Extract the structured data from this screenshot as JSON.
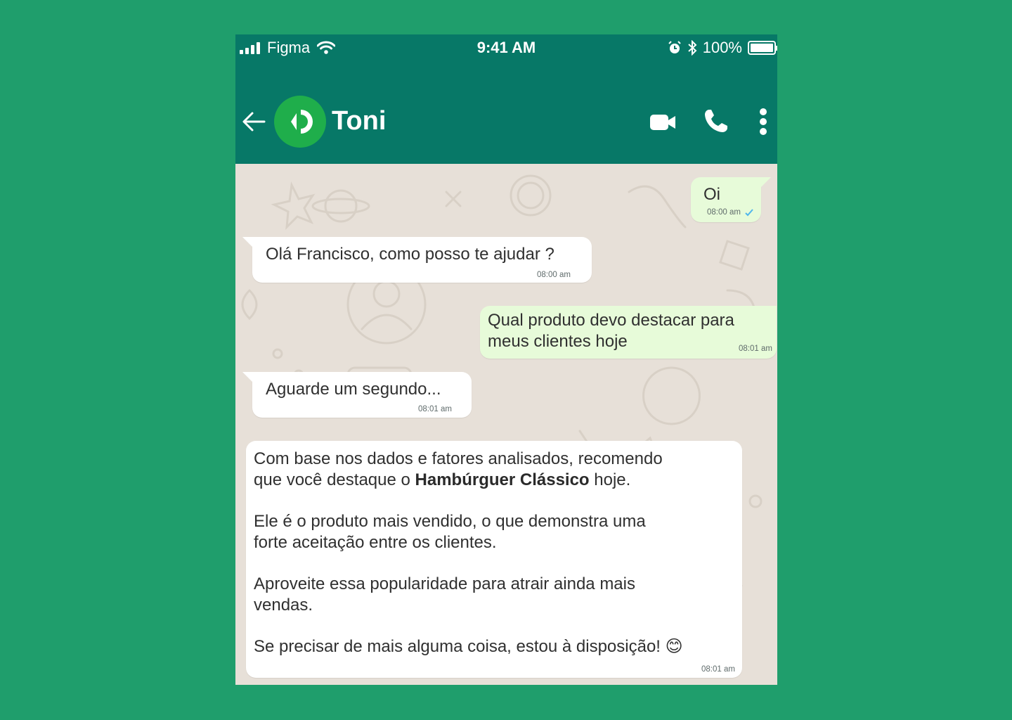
{
  "status_bar": {
    "carrier": "Figma",
    "time": "9:41 AM",
    "battery": "100%"
  },
  "header": {
    "contact_name": "Toni",
    "icons": [
      "back-arrow-icon",
      "video-call-icon",
      "phone-icon",
      "more-vertical-icon"
    ]
  },
  "messages": [
    {
      "direction": "out",
      "text": "Oi",
      "time": "08:00 am",
      "status": "delivered-check"
    },
    {
      "direction": "in",
      "text": "Olá Francisco, como posso te ajudar ?",
      "time": "08:00 am"
    },
    {
      "direction": "out",
      "line1": "Qual produto devo destacar para",
      "line2": "meus clientes hoje",
      "time": "08:01 am"
    },
    {
      "direction": "in",
      "text": "Aguarde um segundo...",
      "time": "08:01 am"
    },
    {
      "direction": "in",
      "p1_line1": "Com base nos dados e fatores analisados, recomendo",
      "p1_line2_prefix": "que você destaque o ",
      "p1_bold": "Hambúrguer Clássico",
      "p1_line2_suffix": " hoje.",
      "p2_line1": "Ele é o produto mais vendido, o que demonstra uma",
      "p2_line2": "forte aceitação entre os clientes.",
      "p3_line1": "Aproveite essa popularidade para atrair ainda mais",
      "p3_line2": "vendas.",
      "p4": "Se precisar de mais alguma coisa, estou à disposição! 😊",
      "time": "08:01 am"
    }
  ],
  "colors": {
    "background": "#1f9e6c",
    "header": "#077867",
    "chat_background": "#e7e0d8",
    "incoming_bubble": "#ffffff",
    "outgoing_bubble": "#e7fbd9",
    "avatar": "#1fae4b",
    "read_check": "#4fb6ec"
  }
}
